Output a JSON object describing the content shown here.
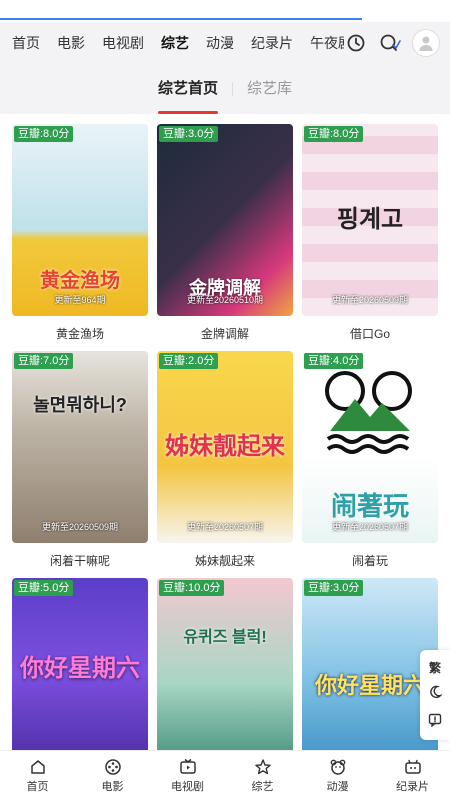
{
  "top_nav": {
    "tabs": [
      {
        "label": "首页",
        "active": false
      },
      {
        "label": "电影",
        "active": false
      },
      {
        "label": "电视剧",
        "active": false
      },
      {
        "label": "综艺",
        "active": true
      },
      {
        "label": "动漫",
        "active": false
      },
      {
        "label": "纪录片",
        "active": false
      },
      {
        "label": "午夜剧",
        "active": false
      }
    ],
    "icons": [
      "history-icon",
      "search-icon",
      "avatar-icon"
    ]
  },
  "sub_tabs": {
    "items": [
      {
        "label": "综艺首页",
        "active": true
      },
      {
        "label": "综艺库",
        "active": false
      }
    ]
  },
  "cards": [
    {
      "score": "豆瓣:8.0分",
      "update": "更新至964期",
      "title": "黄金渔场",
      "poster_text": "黄金渔场"
    },
    {
      "score": "豆瓣:3.0分",
      "update": "更新至20260510期",
      "title": "金牌调解",
      "poster_text": "金牌调解"
    },
    {
      "score": "豆瓣:8.0分",
      "update": "更新至20260509期",
      "title": "借口Go",
      "poster_text": "핑계고"
    },
    {
      "score": "豆瓣:7.0分",
      "update": "更新至20260509期",
      "title": "闲着干嘛呢",
      "poster_text": "놀면뭐하니?"
    },
    {
      "score": "豆瓣:2.0分",
      "update": "更新至20260507期",
      "title": "姊妹靓起来",
      "poster_text": "姊妹靓起来"
    },
    {
      "score": "豆瓣:4.0分",
      "update": "更新至20260507期",
      "title": "闹着玩",
      "poster_text": "闹著玩"
    },
    {
      "score": "豆瓣:5.0分",
      "update": "",
      "title": "",
      "poster_text": "你好星期六"
    },
    {
      "score": "豆瓣:10.0分",
      "update": "",
      "title": "",
      "poster_text": "유퀴즈 블럭!"
    },
    {
      "score": "豆瓣:3.0分",
      "update": "",
      "title": "",
      "poster_text": "你好星期六"
    }
  ],
  "side_float": {
    "trad_label": "繁"
  },
  "bottom_nav": {
    "items": [
      {
        "label": "首页",
        "icon": "home-icon"
      },
      {
        "label": "电影",
        "icon": "film-reel-icon"
      },
      {
        "label": "电视剧",
        "icon": "tv-icon"
      },
      {
        "label": "综艺",
        "icon": "star-icon"
      },
      {
        "label": "动漫",
        "icon": "bear-icon"
      },
      {
        "label": "纪录片",
        "icon": "camera-icon"
      }
    ]
  },
  "colors": {
    "accent_red": "#e53935",
    "score_green": "#2e9e4f",
    "progress_blue": "#3b82f6"
  }
}
